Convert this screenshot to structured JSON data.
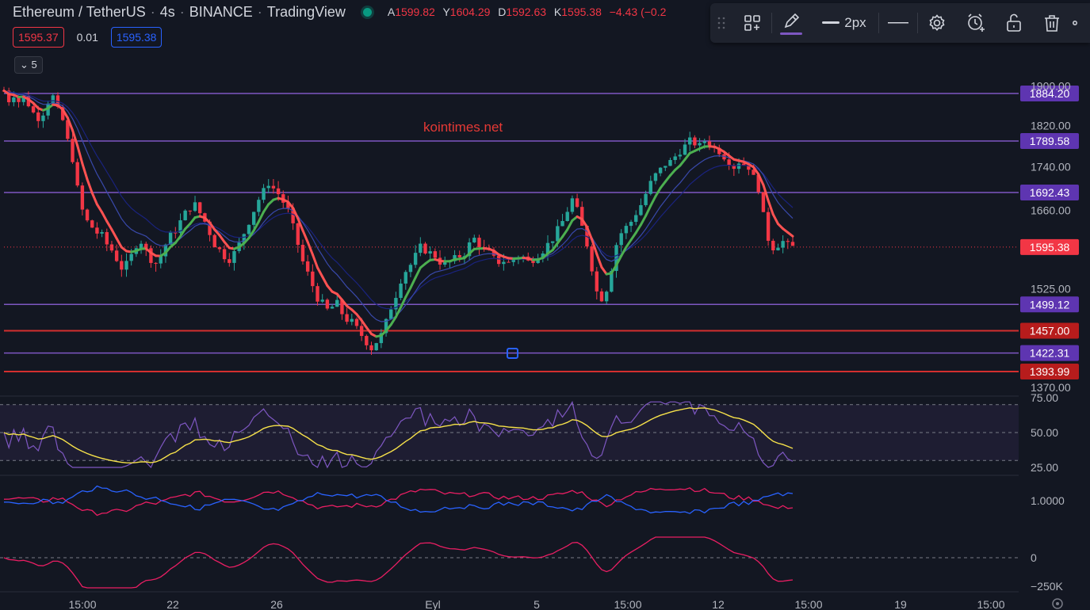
{
  "header": {
    "title_parts": [
      "Ethereum / TetherUS",
      "4s",
      "BINANCE",
      "TradingView"
    ],
    "ohlc": {
      "o_label": "A",
      "o": "1599.82",
      "h_label": "Y",
      "h": "1604.29",
      "l_label": "D",
      "l": "1592.63",
      "c_label": "K",
      "c": "1595.38",
      "change": "−4.43 (−0.2"
    }
  },
  "quote": {
    "sell": "1595.37",
    "spread": "0.01",
    "buy": "1595.38"
  },
  "collapse": {
    "count": "5"
  },
  "toolbar": {
    "stroke_width": "2px",
    "icons": [
      "drag-handle-icon",
      "object-tree-icon",
      "pencil-icon",
      "line-width-icon",
      "line-style-icon",
      "settings-icon",
      "add-alert-icon",
      "lock-icon",
      "trash-icon",
      "more-icon"
    ]
  },
  "watermark": "kointimes.net",
  "colors": {
    "background": "#131722",
    "up": "#26a69a",
    "down": "#f23645",
    "level": "#7e57c2",
    "level_red": "#d32f2f",
    "ma_up": "#4caf50",
    "ma_down": "#ff5252",
    "rsi": "#7e57c2",
    "rsi_ma": "#f6e14a",
    "pink": "#e91e63",
    "blue": "#2962ff"
  },
  "chart_data": {
    "type": "candlestick",
    "price_axis": {
      "range": [
        1370,
        1910
      ],
      "ticks": [
        "1900.00",
        "1820.00",
        "1740.00",
        "1660.00",
        "1525.00",
        "1370.00"
      ]
    },
    "horizontal_levels": [
      {
        "value": "1884.20",
        "color": "purple"
      },
      {
        "value": "1789.58",
        "color": "purple"
      },
      {
        "value": "1692.43",
        "color": "purple"
      },
      {
        "value": "1499.12",
        "color": "purple"
      },
      {
        "value": "1457.00",
        "color": "red"
      },
      {
        "value": "1422.31",
        "color": "purple"
      },
      {
        "value": "1393.99",
        "color": "red"
      }
    ],
    "last_price": "1595.38",
    "time_axis": [
      "15:00",
      "22",
      "26",
      "Eyl",
      "5",
      "15:00",
      "12",
      "15:00",
      "19",
      "15:00"
    ],
    "price_path": [
      1890,
      1870,
      1882,
      1868,
      1877,
      1862,
      1845,
      1835,
      1845,
      1868,
      1878,
      1850,
      1830,
      1790,
      1755,
      1700,
      1660,
      1640,
      1630,
      1620,
      1615,
      1600,
      1590,
      1575,
      1560,
      1565,
      1580,
      1600,
      1605,
      1590,
      1575,
      1568,
      1580,
      1600,
      1615,
      1625,
      1640,
      1655,
      1665,
      1670,
      1655,
      1640,
      1620,
      1600,
      1590,
      1580,
      1575,
      1585,
      1600,
      1620,
      1640,
      1660,
      1680,
      1695,
      1710,
      1700,
      1690,
      1675,
      1660,
      1630,
      1600,
      1570,
      1550,
      1530,
      1510,
      1500,
      1490,
      1495,
      1500,
      1485,
      1475,
      1470,
      1460,
      1450,
      1440,
      1430,
      1440,
      1450,
      1470,
      1495,
      1515,
      1540,
      1555,
      1565,
      1580,
      1595,
      1590,
      1585,
      1580,
      1570,
      1565,
      1570,
      1575,
      1580,
      1585,
      1600,
      1610,
      1600,
      1590,
      1585,
      1575,
      1570,
      1572,
      1568,
      1574,
      1580,
      1578,
      1570,
      1575,
      1582,
      1590,
      1600,
      1610,
      1625,
      1640,
      1660,
      1680,
      1660,
      1630,
      1600,
      1560,
      1520,
      1510,
      1525,
      1560,
      1600,
      1620,
      1630,
      1640,
      1655,
      1670,
      1690,
      1710,
      1725,
      1735,
      1745,
      1750,
      1760,
      1770,
      1780,
      1790,
      1785,
      1780,
      1790,
      1785,
      1775,
      1770,
      1760,
      1750,
      1740,
      1750,
      1745,
      1740,
      1720,
      1700,
      1650,
      1610,
      1595,
      1600,
      1605,
      1598,
      1595
    ],
    "rsi": {
      "ticks": [
        "75.00",
        "50.00",
        "25.00"
      ],
      "upper": 70,
      "lower": 30
    },
    "indicator2": {
      "ticks": [
        "1.0000"
      ]
    },
    "indicator3": {
      "ticks": [
        "0",
        "−250K"
      ]
    }
  }
}
